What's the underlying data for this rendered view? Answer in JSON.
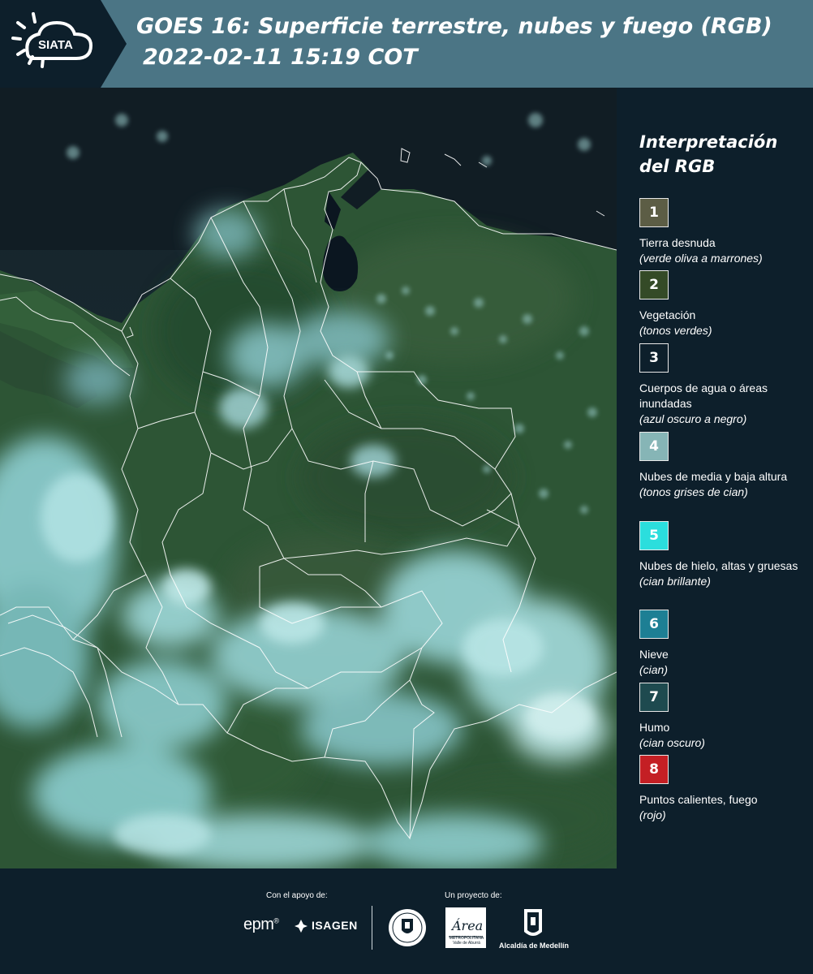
{
  "header": {
    "logo_text": "SIATA",
    "title_line1": "GOES 16: Superficie terrestre, nubes y fuego (RGB)",
    "title_line2": "2022-02-11 15:19 COT",
    "background_color": "#4b7585",
    "logo_panel_color": "#0d1f2b"
  },
  "map": {
    "subject": "GOES 16 RGB satellite composite over Colombia with department borders",
    "border_color": "#ffffff",
    "land_color": "#2d5a37",
    "cloud_color": "#9fd6d8",
    "water_color": "#0a1622"
  },
  "legend": {
    "title_line1": "Interpretación",
    "title_line2": "del RGB",
    "items": [
      {
        "number": "1",
        "color": "#5c5d45",
        "label": "Tierra desnuda",
        "note": "(verde oliva a marrones)"
      },
      {
        "number": "2",
        "color": "#344a27",
        "label": "Vegetación",
        "note": "(tonos verdes)"
      },
      {
        "number": "3",
        "color": "#0d1f2b",
        "label": "Cuerpos de agua o áreas inundadas",
        "note": "(azul oscuro a negro)"
      },
      {
        "number": "4",
        "color": "#86b5b6",
        "label": "Nubes de media y baja altura",
        "note": "(tonos grises de cian)"
      },
      {
        "number": "5",
        "color": "#2bdedd",
        "label": "Nubes de hielo, altas y gruesas",
        "note": "(cian brillante)"
      },
      {
        "number": "6",
        "color": "#1d7f94",
        "label": "Nieve",
        "note": "(cian)"
      },
      {
        "number": "7",
        "color": "#1e4a4f",
        "label": "Humo",
        "note": "(cian oscuro)"
      },
      {
        "number": "8",
        "color": "#c41f24",
        "label": "Puntos calientes, fuego",
        "note": "(rojo)"
      }
    ]
  },
  "footer": {
    "support_caption": "Con el apoyo de:",
    "project_caption": "Un proyecto de:",
    "epm_text": "epm",
    "epm_mark": "®",
    "isagen_text": "ISAGEN",
    "metro_label": "METROPOLITANA Valle de Aburrá",
    "metro_script": "Área",
    "alcaldia_text": "Alcaldía de Medellín"
  }
}
